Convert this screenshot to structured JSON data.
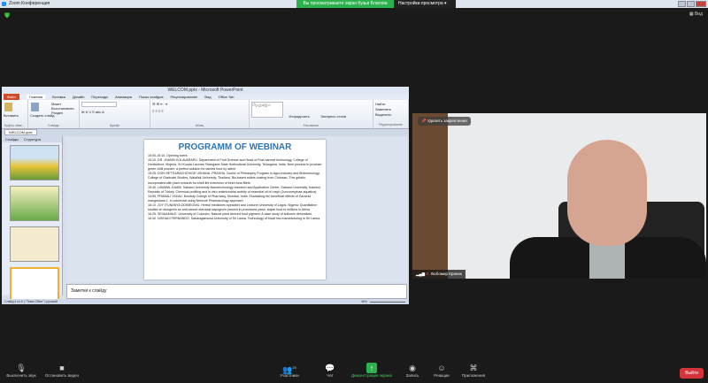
{
  "zoom": {
    "window_title": "Zoom Конференция",
    "view_badge": "Вы просматриваете экран Кузья Благова",
    "view_options": "Настройки просмотра",
    "view_button": "Вид"
  },
  "ppt": {
    "title": "WELCOM.pptx - Microsoft PowerPoint",
    "tabs": [
      "Файл",
      "Главная",
      "Вставка",
      "Дизайн",
      "Переходы",
      "Анимация",
      "Показ слайдов",
      "Рецензирование",
      "Вид",
      "Office Tab"
    ],
    "groups": [
      "Буфер обме...",
      "Слайды",
      "Шрифт",
      "Абзац",
      "Рисование",
      "Редактирование"
    ],
    "ribbon_labels": {
      "paste": "Вставить",
      "new_slide": "Создать слайд",
      "layout": "Макет",
      "reset": "Восстановить",
      "section": "Раздел",
      "arrange": "Упорядочить",
      "quick_styles": "Экспресс-стили",
      "find": "Найти",
      "replace": "Заменить",
      "select": "Выделить"
    },
    "doc_tab": "WELCOM.pptx",
    "panel_tabs": [
      "Слайды",
      "Структура"
    ],
    "notes_placeholder": "Заметки к слайду",
    "status": {
      "slide": "Слайд 4 из 5",
      "theme": "\"Тема Office\"",
      "lang": "русский",
      "zoom": "48%"
    },
    "slide": {
      "title": "PROGRAMM OF WEBINAR",
      "lines": [
        "15:00-15:10. Opening event.",
        "15:10. DR. JHANSI KOLAVARAPU. Department of Fruit Science and Head of Post-harvest technology, College of Horticulture, Mojerla, Sri Konda Laxman Telangana State Horticultural University, Telangana, India. New process to produce green chilli powder: a perfect solution for tainted food by latent",
        "15:25. DON HETTIARACHCHIGE USHANA. PRASHA. Doctor of Philosophy Program in Agro-Industry and Biotechnology, College of Graduate Studies, Walailak University, Thailand. Bio-based edible coating from Chitosan. This gelatin incorporated with plant extracts for shelf-life extension of fresh tuna fillets",
        "15:40. LAWWAL KAABI. Sabanci University Nanotechnology research and Application Center, Sabanci University, Istanbul, Republic of Turkey. Chemical profiling and in vitro antimicrobial activity of essential oil of rosyh (Juncosmyinae aquatica).",
        "15:55. PRANALI YADAV. Bombay College of Pharmacy, Mumbai, India. Elucidating the beneficial effects of Garcinia mangostana L. in colorectal using Network Pharmacology approach",
        "16:10. JOY ITUNANYA ODIMEGWU. Herbal medicines specialist and Lecturer University of Lagos, Nigeria. Quantitative studies on diosgenin an anti-cancer steroidal sapogenin present in processed yams, staple food to millions in Africa",
        "16:25. SEVAAMALE. University of Colombo. Natural plant derived food pigment: A case study of shikonin derivatives.",
        "16:40. NISHADI FERNANDO. Sabaragamuwa University of Sri Lanka. Technology of black tea manufacturing in Sri Lanka."
      ]
    }
  },
  "video": {
    "unpin": "Удалить закрепление",
    "participant": "Любомир Краник"
  },
  "toolbar": {
    "mute": "Выключить звук",
    "video": "Остановить видео",
    "participants": "Участники",
    "participants_count": "20",
    "chat": "Чат",
    "share": "Демонстрация экрана",
    "record": "Запись",
    "reactions": "Реакции",
    "apps": "Приложения",
    "leave": "Выйти"
  }
}
